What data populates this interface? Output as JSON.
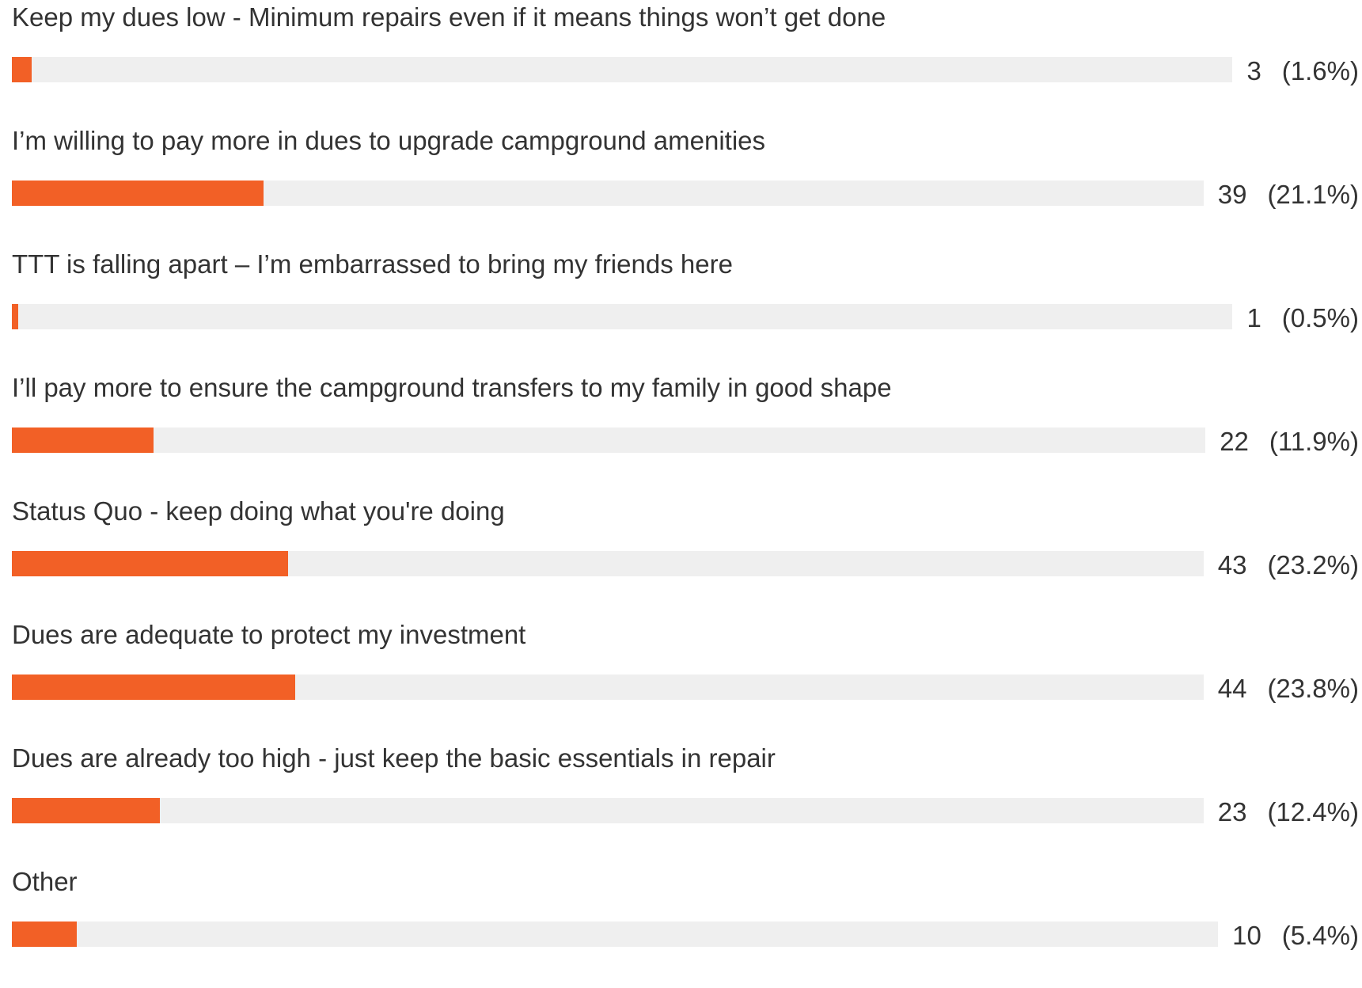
{
  "chart_data": {
    "type": "bar",
    "orientation": "horizontal",
    "bar_color": "#f26026",
    "track_color": "#efefef",
    "grid": false,
    "categories": [
      "Keep my dues low - Minimum repairs even if it means things won’t get done",
      "I’m willing to pay more in dues to upgrade campground amenities",
      "TTT is falling apart – I’m embarrassed to bring my friends here",
      "I’ll pay more to ensure the campground transfers to my family in good shape",
      "Status Quo - keep doing what you're doing",
      "Dues are adequate to protect my investment",
      "Dues are already too high - just keep the basic essentials in repair",
      "Other"
    ],
    "values": [
      3,
      39,
      1,
      22,
      43,
      44,
      23,
      10
    ],
    "percent_labels": [
      "(1.6%)",
      "(21.1%)",
      "(0.5%)",
      "(11.9%)",
      "(23.2%)",
      "(23.8%)",
      "(12.4%)",
      "(5.4%)"
    ],
    "percent_values": [
      1.6,
      21.1,
      0.5,
      11.9,
      23.2,
      23.8,
      12.4,
      5.4
    ],
    "value_range": [
      0,
      100
    ]
  }
}
